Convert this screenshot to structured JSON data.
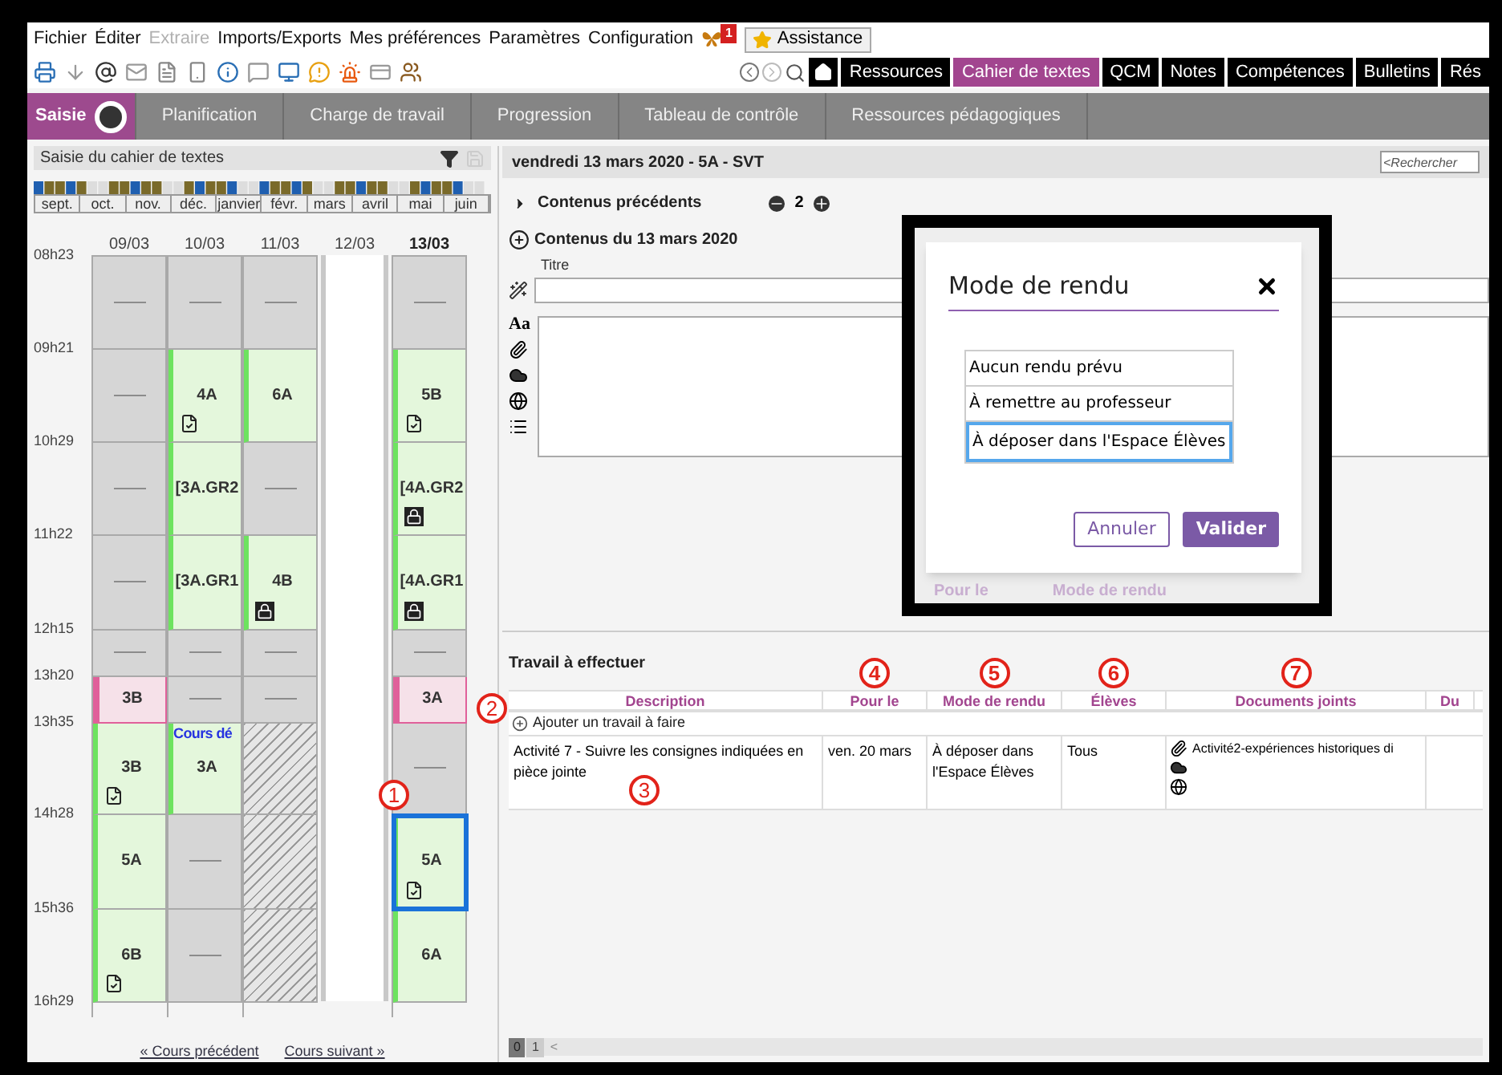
{
  "menu": [
    {
      "label": "Fichier",
      "disabled": false
    },
    {
      "label": "Éditer",
      "disabled": false
    },
    {
      "label": "Extraire",
      "disabled": true
    },
    {
      "label": "Imports/Exports",
      "disabled": false
    },
    {
      "label": "Mes préférences",
      "disabled": false
    },
    {
      "label": "Paramètres",
      "disabled": false
    },
    {
      "label": "Configuration",
      "disabled": false
    }
  ],
  "notification_count": "1",
  "assistance": "Assistance",
  "tabs": [
    {
      "label": "Ressources",
      "selected": false
    },
    {
      "label": "Cahier de textes",
      "selected": true
    },
    {
      "label": "QCM",
      "selected": false
    },
    {
      "label": "Notes",
      "selected": false
    },
    {
      "label": "Compétences",
      "selected": false
    },
    {
      "label": "Bulletins",
      "selected": false
    },
    {
      "label": "Rés",
      "selected": false
    }
  ],
  "subnav": [
    {
      "label": "Saisie",
      "selected": true
    },
    {
      "label": "Planification",
      "selected": false
    },
    {
      "label": "Charge de travail",
      "selected": false
    },
    {
      "label": "Progression",
      "selected": false
    },
    {
      "label": "Tableau de contrôle",
      "selected": false
    },
    {
      "label": "Ressources pédagogiques",
      "selected": false
    }
  ],
  "left_panel": {
    "title": "Saisie du cahier de textes",
    "months": [
      "sept.",
      "oct.",
      "nov.",
      "déc.",
      "janvier",
      "févr.",
      "mars",
      "avril",
      "mai",
      "juin"
    ],
    "times": [
      "08h23",
      "09h21",
      "10h29",
      "11h22",
      "12h15",
      "13h20",
      "13h35",
      "14h28",
      "15h36",
      "16h29"
    ],
    "days": [
      {
        "label": "09/03",
        "kind": "day",
        "selected": false,
        "cells": [
          {
            "kind": "empty",
            "selected": false
          },
          {
            "kind": "empty",
            "selected": false
          },
          {
            "kind": "empty",
            "selected": false
          },
          {
            "kind": "empty",
            "selected": false
          },
          {
            "kind": "empty",
            "selected": false
          },
          {
            "kind": "cancelled",
            "label": "3B",
            "selected": false
          },
          {
            "kind": "homework",
            "label": "3B",
            "selected": false
          },
          {
            "kind": "course",
            "label": "5A",
            "selected": false
          },
          {
            "kind": "homework",
            "label": "6B",
            "selected": false
          }
        ]
      },
      {
        "label": "10/03",
        "kind": "day",
        "selected": false,
        "cells": [
          {
            "kind": "empty",
            "selected": false
          },
          {
            "kind": "homework",
            "label": "4A",
            "selected": false
          },
          {
            "kind": "course",
            "label": "[3A.GR2",
            "selected": false
          },
          {
            "kind": "course",
            "label": "[3A.GR1",
            "selected": false
          },
          {
            "kind": "empty",
            "selected": false
          },
          {
            "kind": "empty",
            "selected": false
          },
          {
            "kind": "course",
            "label": "3A",
            "note": "Cours dé",
            "selected": false
          },
          {
            "kind": "empty",
            "selected": false
          },
          {
            "kind": "empty",
            "selected": false
          }
        ]
      },
      {
        "label": "11/03",
        "kind": "day",
        "selected": false,
        "cells": [
          {
            "kind": "empty",
            "selected": false
          },
          {
            "kind": "course",
            "label": "6A",
            "selected": false
          },
          {
            "kind": "empty",
            "selected": false
          },
          {
            "kind": "locked",
            "label": "4B",
            "selected": false
          },
          {
            "kind": "empty",
            "selected": false
          },
          {
            "kind": "empty",
            "selected": false
          },
          {
            "kind": "hatched",
            "selected": false
          },
          {
            "kind": "hatched",
            "selected": false
          },
          {
            "kind": "hatched",
            "selected": false
          }
        ]
      },
      {
        "label": "12/03",
        "kind": "off",
        "selected": false
      },
      {
        "label": "13/03",
        "kind": "day",
        "selected": true,
        "cells": [
          {
            "kind": "empty",
            "selected": false
          },
          {
            "kind": "homework",
            "label": "5B",
            "selected": false
          },
          {
            "kind": "locked",
            "label": "[4A.GR2",
            "selected": false
          },
          {
            "kind": "locked",
            "label": "[4A.GR1",
            "selected": false
          },
          {
            "kind": "empty",
            "selected": false
          },
          {
            "kind": "cancelled",
            "label": "3A",
            "selected": false
          },
          {
            "kind": "empty",
            "selected": false
          },
          {
            "kind": "homework",
            "label": "5A",
            "selected": true,
            "marker": "1"
          },
          {
            "kind": "course",
            "label": "6A",
            "selected": false
          }
        ]
      }
    ],
    "prev_link": "« Cours précédent",
    "next_link": "Cours suivant »"
  },
  "lesson": {
    "header": "vendredi 13 mars 2020 - 5A - SVT",
    "search_placeholder": "<Rechercher",
    "previous_label": "Contenus précédents",
    "previous_count": "2",
    "contents_label": "Contenus du 13 mars 2020",
    "title_label": "Titre",
    "format_label": "Aa"
  },
  "dialog": {
    "title": "Mode de rendu",
    "options": [
      {
        "label": "Aucun rendu prévu",
        "selected": false
      },
      {
        "label": "À remettre au professeur",
        "selected": false
      },
      {
        "label": "À déposer dans l'Espace Élèves",
        "selected": true
      }
    ],
    "cancel": "Annuler",
    "confirm": "Valider",
    "behind": [
      "Pour le",
      "Mode de rendu"
    ]
  },
  "homework": {
    "title": "Travail à effectuer",
    "columns": [
      {
        "label": "Description"
      },
      {
        "label": "Pour le",
        "marker": "4"
      },
      {
        "label": "Mode de rendu",
        "marker": "5"
      },
      {
        "label": "Élèves",
        "marker": "6"
      },
      {
        "label": "Documents joints",
        "marker": "7"
      },
      {
        "label": "Du"
      }
    ],
    "add_label": "Ajouter un travail à faire",
    "add_marker": "2",
    "rows": [
      {
        "description": "Activité 7 - Suivre les consignes indiquées en pièce jointe",
        "marker": "3",
        "due": "ven. 20 mars",
        "mode": "À déposer dans l'Espace Élèves",
        "students": "Tous",
        "document": "Activité2-expériences historiques di"
      }
    ]
  },
  "pager": [
    {
      "label": "0",
      "selected": true
    },
    {
      "label": "1",
      "selected": false
    }
  ],
  "pager_back": "<"
}
